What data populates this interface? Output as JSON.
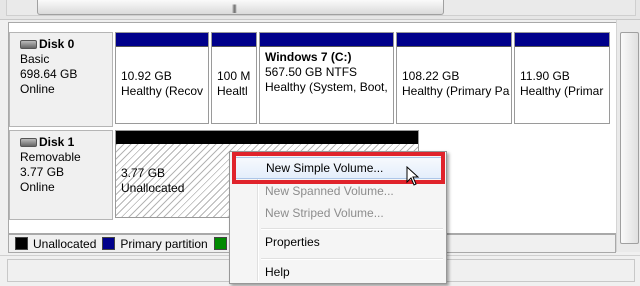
{
  "colors": {
    "unallocated": "#000000",
    "primary_partition": "#00008b",
    "extended_partition": "#008a00",
    "highlight_box": "#e0232b"
  },
  "disks": [
    {
      "name": "Disk 0",
      "type": "Basic",
      "size": "698.64 GB",
      "status": "Online",
      "partitions": [
        {
          "name": "",
          "size": "10.92 GB",
          "status": "Healthy (Recov"
        },
        {
          "name": "",
          "size": "100 M",
          "status": "Healtl"
        },
        {
          "name": "Windows 7  (C:)",
          "size": "567.50 GB NTFS",
          "status": "Healthy (System, Boot,"
        },
        {
          "name": "",
          "size": "108.22 GB",
          "status": "Healthy (Primary Pa"
        },
        {
          "name": "",
          "size": "11.90 GB",
          "status": "Healthy (Primar"
        }
      ]
    },
    {
      "name": "Disk 1",
      "type": "Removable",
      "size": "3.77 GB",
      "status": "Online",
      "partitions": [
        {
          "size": "3.77 GB",
          "status": "Unallocated"
        }
      ]
    }
  ],
  "legend": [
    {
      "label": "Unallocated",
      "color": "#000000"
    },
    {
      "label": "Primary partition",
      "color": "#00008b"
    },
    {
      "label": "E",
      "color": "#008a00"
    }
  ],
  "scroll_grip": "|||",
  "context_menu": {
    "items": [
      {
        "label": "New Simple Volume...",
        "enabled": true,
        "highlighted": true
      },
      {
        "label": "New Spanned Volume...",
        "enabled": false
      },
      {
        "label": "New Striped Volume...",
        "enabled": false
      },
      {
        "label": "Properties",
        "enabled": true
      },
      {
        "label": "Help",
        "enabled": true
      }
    ]
  }
}
